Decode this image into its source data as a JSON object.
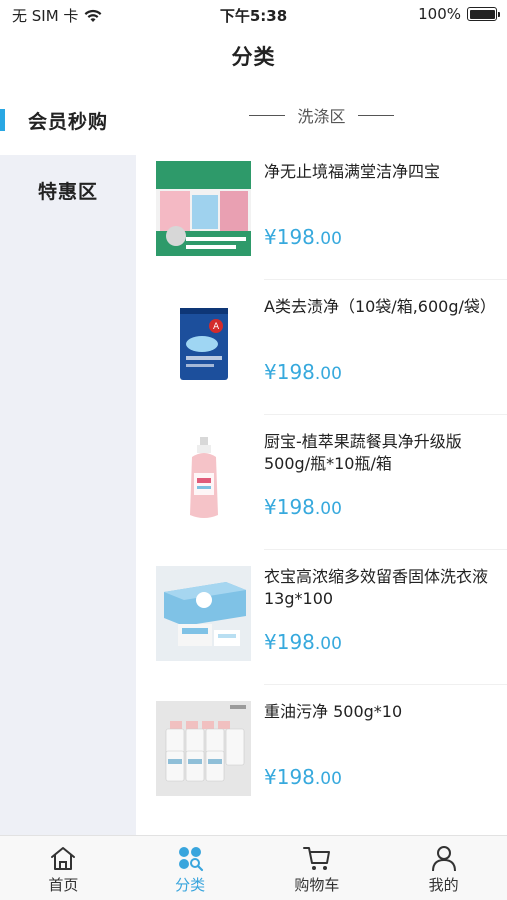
{
  "status_bar": {
    "carrier": "无 SIM 卡",
    "time": "下午5:38",
    "battery": "100%"
  },
  "nav": {
    "title": "分类"
  },
  "sidebar": {
    "items": [
      {
        "label": "会员秒购",
        "active": true
      },
      {
        "label": "特惠区",
        "active": false
      }
    ]
  },
  "section": {
    "title": "洗涤区"
  },
  "products": [
    {
      "name": "净无止境福满堂洁净四宝",
      "price_main": "¥198",
      "price_cents": ".00",
      "image": "cleaning-set-box-image"
    },
    {
      "name": "A类去渍净（10袋/箱,600g/袋）",
      "price_main": "¥198",
      "price_cents": ".00",
      "image": "detergent-bag-image"
    },
    {
      "name": "厨宝-植萃果蔬餐具净升级版500g/瓶*10瓶/箱",
      "price_main": "¥198",
      "price_cents": ".00",
      "image": "dish-soap-bottle-image"
    },
    {
      "name": "衣宝高浓缩多效留香固体洗衣液 13g*100",
      "price_main": "¥198",
      "price_cents": ".00",
      "image": "laundry-pods-box-image"
    },
    {
      "name": "重油污净 500g*10",
      "price_main": "¥198",
      "price_cents": ".00",
      "image": "degreaser-bottles-image"
    }
  ],
  "tabs": [
    {
      "label": "首页",
      "icon": "home-icon",
      "active": false
    },
    {
      "label": "分类",
      "icon": "category-icon",
      "active": true
    },
    {
      "label": "购物车",
      "icon": "cart-icon",
      "active": false
    },
    {
      "label": "我的",
      "icon": "user-icon",
      "active": false
    }
  ],
  "colors": {
    "accent": "#39a5dd",
    "price": "#37a9dd",
    "sidebar_bg": "#eef0f6"
  }
}
